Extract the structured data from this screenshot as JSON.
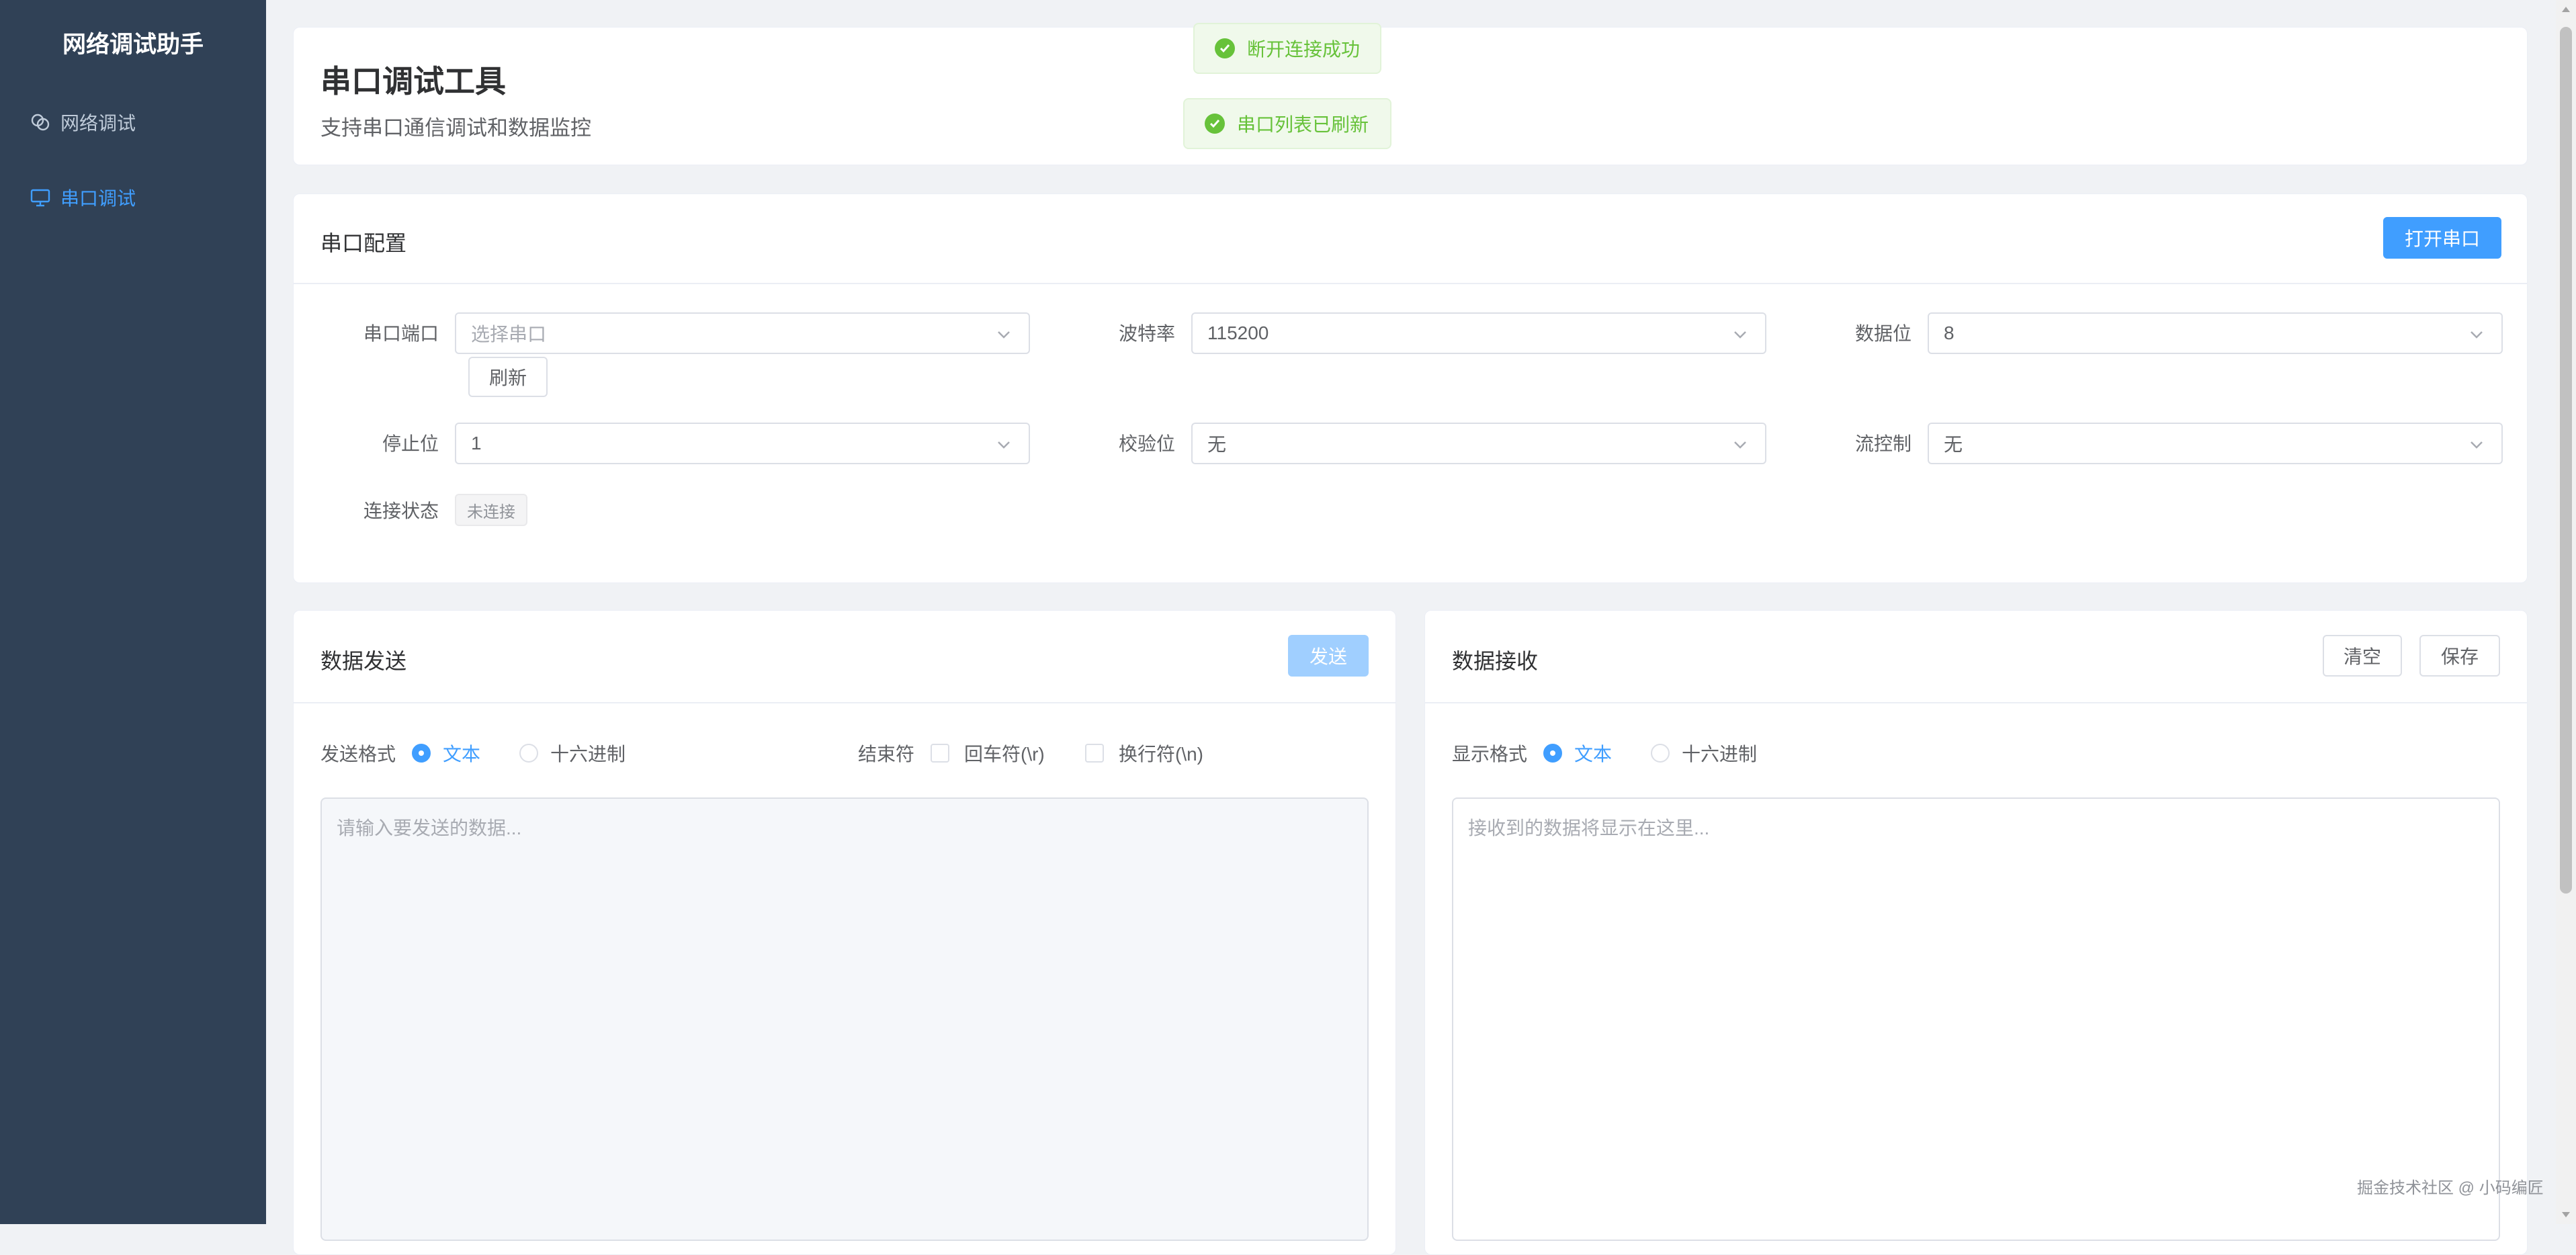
{
  "sidebar": {
    "app_title": "网络调试助手",
    "items": [
      {
        "label": "网络调试",
        "icon": "link-icon",
        "active": false
      },
      {
        "label": "串口调试",
        "icon": "monitor-icon",
        "active": true
      }
    ]
  },
  "header": {
    "title": "串口调试工具",
    "subtitle": "支持串口通信调试和数据监控"
  },
  "toasts": [
    {
      "text": "断开连接成功",
      "type": "success"
    },
    {
      "text": "串口列表已刷新",
      "type": "success"
    }
  ],
  "serial_config": {
    "title": "串口配置",
    "open_button": "打开串口",
    "port": {
      "label": "串口端口",
      "placeholder": "选择串口",
      "value": ""
    },
    "refresh_button": "刷新",
    "baud_rate": {
      "label": "波特率",
      "value": "115200"
    },
    "data_bits": {
      "label": "数据位",
      "value": "8"
    },
    "stop_bits": {
      "label": "停止位",
      "value": "1"
    },
    "parity": {
      "label": "校验位",
      "value": "无"
    },
    "flow_control": {
      "label": "流控制",
      "value": "无"
    },
    "status": {
      "label": "连接状态",
      "value": "未连接"
    }
  },
  "send_panel": {
    "title": "数据发送",
    "send_button": "发送",
    "format_label": "发送格式",
    "format_options": [
      {
        "label": "文本",
        "checked": true
      },
      {
        "label": "十六进制",
        "checked": false
      }
    ],
    "terminator_label": "结束符",
    "terminator_options": [
      {
        "label": "回车符(\\r)",
        "checked": false
      },
      {
        "label": "换行符(\\n)",
        "checked": false
      }
    ],
    "placeholder": "请输入要发送的数据..."
  },
  "receive_panel": {
    "title": "数据接收",
    "clear_button": "清空",
    "save_button": "保存",
    "format_label": "显示格式",
    "format_options": [
      {
        "label": "文本",
        "checked": true
      },
      {
        "label": "十六进制",
        "checked": false
      }
    ],
    "placeholder": "接收到的数据将显示在这里..."
  },
  "watermark": "掘金技术社区 @ 小码编匠",
  "colors": {
    "sidebar_bg": "#304156",
    "accent": "#409eff",
    "success": "#67c23a",
    "page_bg": "#f0f2f5"
  }
}
